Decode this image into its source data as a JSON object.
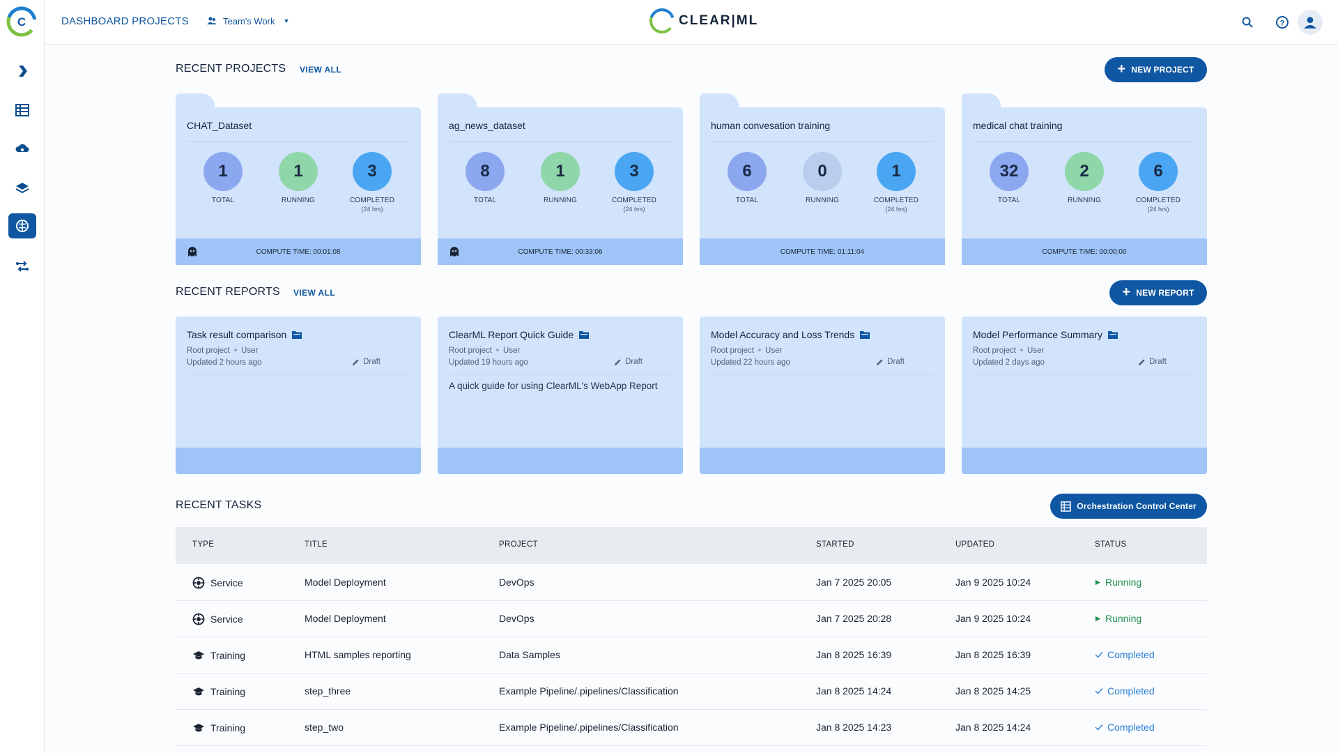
{
  "header": {
    "breadcrumb": "DASHBOARD PROJECTS",
    "workspace": "Team's Work",
    "brand": "CLEAR|ML"
  },
  "sections": {
    "projects_title": "RECENT PROJECTS",
    "reports_title": "RECENT REPORTS",
    "tasks_title": "RECENT TASKS",
    "view_all": "VIEW ALL",
    "new_project": "NEW PROJECT",
    "new_report": "NEW REPORT",
    "orchestration": "Orchestration Control Center"
  },
  "stat_labels": {
    "total": "TOTAL",
    "running": "RUNNING",
    "completed": "COMPLETED",
    "completed_sub": "(24 hrs)"
  },
  "colors": {
    "total": "#8ba7ef",
    "running": "#8fd6a9",
    "running_zero": "#b9cdec",
    "completed": "#4aa6f2",
    "accent": "#0f57a2"
  },
  "projects": [
    {
      "name": "CHAT_Dataset",
      "total": "1",
      "running": "1",
      "completed": "3",
      "compute": "COMPUTE TIME: 00:01:08",
      "ghost": true
    },
    {
      "name": "ag_news_dataset",
      "total": "8",
      "running": "1",
      "completed": "3",
      "compute": "COMPUTE TIME: 00:33:06",
      "ghost": true
    },
    {
      "name": "human convesation training",
      "total": "6",
      "running": "0",
      "completed": "1",
      "compute": "COMPUTE TIME: 01:11:04",
      "ghost": false
    },
    {
      "name": "medical chat training",
      "total": "32",
      "running": "2",
      "completed": "6",
      "compute": "COMPUTE TIME: 00:00:00",
      "ghost": false
    }
  ],
  "reports": [
    {
      "title": "Task result comparison",
      "project": "Root project",
      "user": "User",
      "updated": "Updated 2 hours ago",
      "status": "Draft",
      "description": ""
    },
    {
      "title": "ClearML Report Quick Guide",
      "project": "Root project",
      "user": "User",
      "updated": "Updated 19 hours ago",
      "status": "Draft",
      "description": "A quick guide for using ClearML's WebApp Report"
    },
    {
      "title": "Model Accuracy and Loss Trends",
      "project": "Root project",
      "user": "User",
      "updated": "Updated 22 hours ago",
      "status": "Draft",
      "description": ""
    },
    {
      "title": "Model Performance Summary",
      "project": "Root project",
      "user": "User",
      "updated": "Updated 2 days ago",
      "status": "Draft",
      "description": ""
    }
  ],
  "tasks": {
    "columns": [
      "TYPE",
      "TITLE",
      "PROJECT",
      "STARTED",
      "UPDATED",
      "STATUS"
    ],
    "rows": [
      {
        "type": "Service",
        "title": "Model Deployment",
        "project": "DevOps",
        "started": "Jan 7 2025 20:05",
        "updated": "Jan 9 2025 10:24",
        "status": "Running"
      },
      {
        "type": "Service",
        "title": "Model Deployment",
        "project": "DevOps",
        "started": "Jan 7 2025 20:28",
        "updated": "Jan 9 2025 10:24",
        "status": "Running"
      },
      {
        "type": "Training",
        "title": "HTML samples reporting",
        "project": "Data Samples",
        "started": "Jan 8 2025 16:39",
        "updated": "Jan 8 2025 16:39",
        "status": "Completed"
      },
      {
        "type": "Training",
        "title": "step_three",
        "project": "Example Pipeline/.pipelines/Classification",
        "started": "Jan 8 2025 14:24",
        "updated": "Jan 8 2025 14:25",
        "status": "Completed"
      },
      {
        "type": "Training",
        "title": "step_two",
        "project": "Example Pipeline/.pipelines/Classification",
        "started": "Jan 8 2025 14:23",
        "updated": "Jan 8 2025 14:24",
        "status": "Completed"
      }
    ]
  }
}
